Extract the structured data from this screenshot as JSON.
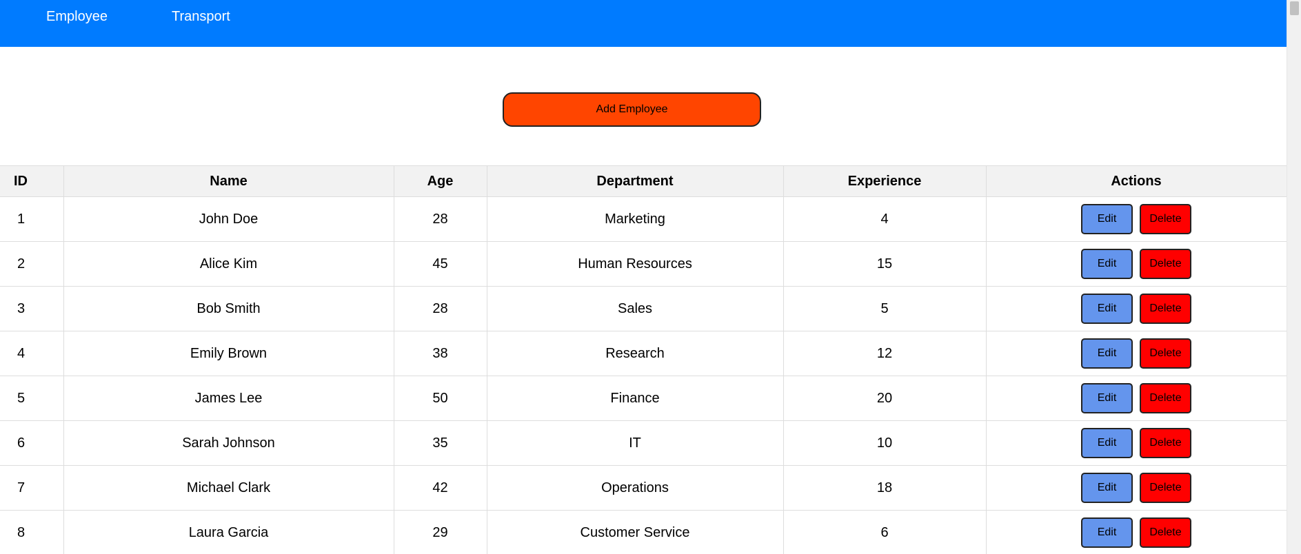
{
  "nav": {
    "items": [
      {
        "label": "Employee"
      },
      {
        "label": "Transport"
      }
    ]
  },
  "add_button_label": "Add Employee",
  "table": {
    "headers": [
      "ID",
      "Name",
      "Age",
      "Department",
      "Experience",
      "Actions"
    ],
    "rows": [
      {
        "id": "1",
        "name": "John Doe",
        "age": "28",
        "department": "Marketing",
        "experience": "4"
      },
      {
        "id": "2",
        "name": "Alice Kim",
        "age": "45",
        "department": "Human Resources",
        "experience": "15"
      },
      {
        "id": "3",
        "name": "Bob Smith",
        "age": "28",
        "department": "Sales",
        "experience": "5"
      },
      {
        "id": "4",
        "name": "Emily Brown",
        "age": "38",
        "department": "Research",
        "experience": "12"
      },
      {
        "id": "5",
        "name": "James Lee",
        "age": "50",
        "department": "Finance",
        "experience": "20"
      },
      {
        "id": "6",
        "name": "Sarah Johnson",
        "age": "35",
        "department": "IT",
        "experience": "10"
      },
      {
        "id": "7",
        "name": "Michael Clark",
        "age": "42",
        "department": "Operations",
        "experience": "18"
      },
      {
        "id": "8",
        "name": "Laura Garcia",
        "age": "29",
        "department": "Customer Service",
        "experience": "6"
      }
    ],
    "edit_label": "Edit",
    "delete_label": "Delete"
  },
  "colors": {
    "navbar": "#007bff",
    "add_button": "#ff4500",
    "edit_button": "#6495ed",
    "delete_button": "#ff0000",
    "header_background": "#f2f2f2"
  }
}
